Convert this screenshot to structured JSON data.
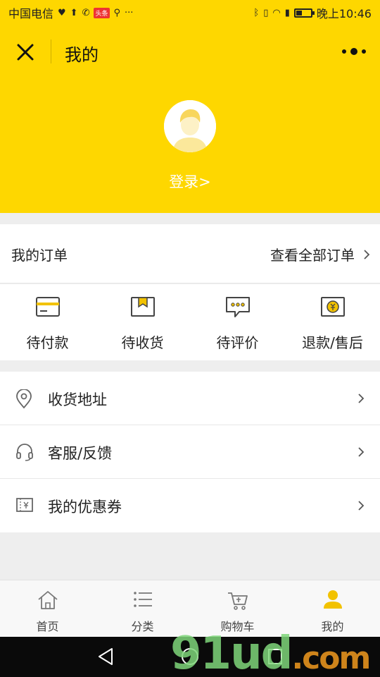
{
  "status_bar": {
    "carrier": "中国电信",
    "time": "晚上10:46",
    "badge": "头条"
  },
  "header": {
    "title": "我的",
    "login_label": "登录>"
  },
  "orders": {
    "title": "我的订单",
    "view_all": "查看全部订单",
    "items": [
      {
        "label": "待付款",
        "icon": "card-icon"
      },
      {
        "label": "待收货",
        "icon": "box-icon"
      },
      {
        "label": "待评价",
        "icon": "comment-icon"
      },
      {
        "label": "退款/售后",
        "icon": "refund-icon"
      }
    ]
  },
  "menu": [
    {
      "label": "收货地址",
      "icon": "location-icon"
    },
    {
      "label": "客服/反馈",
      "icon": "headset-icon"
    },
    {
      "label": "我的优惠券",
      "icon": "coupon-icon"
    }
  ],
  "tabbar": [
    {
      "label": "首页",
      "icon": "home-icon",
      "active": false
    },
    {
      "label": "分类",
      "icon": "list-icon",
      "active": false
    },
    {
      "label": "购物车",
      "icon": "cart-icon",
      "active": false
    },
    {
      "label": "我的",
      "icon": "user-icon",
      "active": true
    }
  ],
  "watermark": {
    "main": "91ud",
    "suffix": ".com"
  },
  "colors": {
    "accent": "#fed700",
    "icon_gray": "#555555",
    "tab_active": "#f2c200"
  }
}
